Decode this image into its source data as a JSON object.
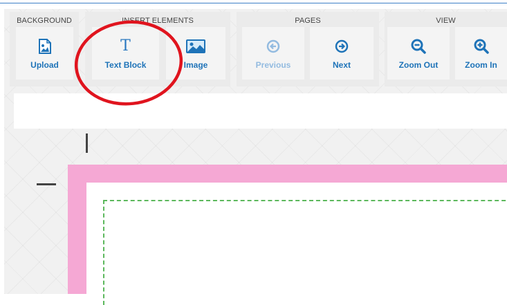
{
  "toolbar": {
    "groups": [
      {
        "title": "BACKGROUND",
        "buttons": [
          {
            "label": "Upload",
            "icon": "upload-image-icon"
          }
        ]
      },
      {
        "title": "INSERT ELEMENTS",
        "buttons": [
          {
            "label": "Text Block",
            "icon": "text-t-icon",
            "glyph": "T"
          },
          {
            "label": "Image",
            "icon": "image-icon"
          }
        ]
      },
      {
        "title": "PAGES",
        "buttons": [
          {
            "label": "Previous",
            "icon": "arrow-left-circle-icon",
            "disabled": true
          },
          {
            "label": "Next",
            "icon": "arrow-right-circle-icon"
          }
        ]
      },
      {
        "title": "VIEW",
        "buttons": [
          {
            "label": "Zoom Out",
            "icon": "zoom-out-icon"
          },
          {
            "label": "Zoom In",
            "icon": "zoom-in-icon"
          }
        ]
      }
    ]
  },
  "colors": {
    "accent": "#1e73b8",
    "disabled": "#93bbe0",
    "page_border": "#f5a8d4",
    "safe_area": "#5cb85c",
    "annotation": "#e0141e"
  }
}
